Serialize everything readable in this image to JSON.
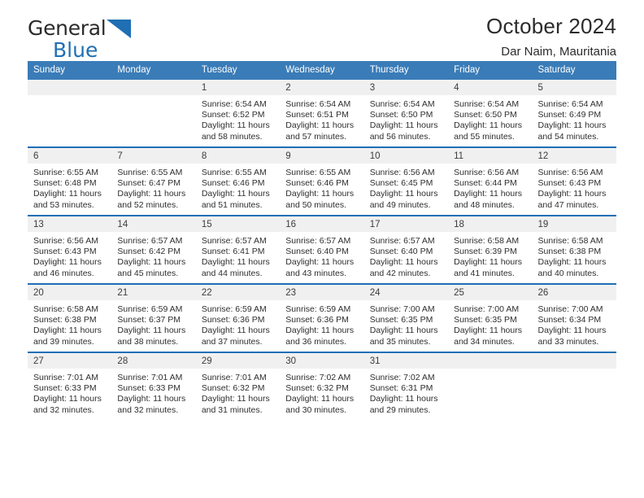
{
  "brand": {
    "line1": "General",
    "line2": "Blue",
    "triangle_color": "#1f6fb5",
    "icon": "triangle-logo-icon"
  },
  "header": {
    "title": "October 2024",
    "subtitle": "Dar Naim, Mauritania"
  },
  "theme": {
    "header_bg": "#3a7cb8",
    "row_divider": "#1f6fb5",
    "daynum_bg": "#f0f0f0",
    "text": "#2e2e2e"
  },
  "weekdays": [
    "Sunday",
    "Monday",
    "Tuesday",
    "Wednesday",
    "Thursday",
    "Friday",
    "Saturday"
  ],
  "weeks": [
    [
      {
        "day": "",
        "sunrise": "",
        "sunset": "",
        "daylight1": "",
        "daylight2": ""
      },
      {
        "day": "",
        "sunrise": "",
        "sunset": "",
        "daylight1": "",
        "daylight2": ""
      },
      {
        "day": "1",
        "sunrise": "Sunrise: 6:54 AM",
        "sunset": "Sunset: 6:52 PM",
        "daylight1": "Daylight: 11 hours",
        "daylight2": "and 58 minutes."
      },
      {
        "day": "2",
        "sunrise": "Sunrise: 6:54 AM",
        "sunset": "Sunset: 6:51 PM",
        "daylight1": "Daylight: 11 hours",
        "daylight2": "and 57 minutes."
      },
      {
        "day": "3",
        "sunrise": "Sunrise: 6:54 AM",
        "sunset": "Sunset: 6:50 PM",
        "daylight1": "Daylight: 11 hours",
        "daylight2": "and 56 minutes."
      },
      {
        "day": "4",
        "sunrise": "Sunrise: 6:54 AM",
        "sunset": "Sunset: 6:50 PM",
        "daylight1": "Daylight: 11 hours",
        "daylight2": "and 55 minutes."
      },
      {
        "day": "5",
        "sunrise": "Sunrise: 6:54 AM",
        "sunset": "Sunset: 6:49 PM",
        "daylight1": "Daylight: 11 hours",
        "daylight2": "and 54 minutes."
      }
    ],
    [
      {
        "day": "6",
        "sunrise": "Sunrise: 6:55 AM",
        "sunset": "Sunset: 6:48 PM",
        "daylight1": "Daylight: 11 hours",
        "daylight2": "and 53 minutes."
      },
      {
        "day": "7",
        "sunrise": "Sunrise: 6:55 AM",
        "sunset": "Sunset: 6:47 PM",
        "daylight1": "Daylight: 11 hours",
        "daylight2": "and 52 minutes."
      },
      {
        "day": "8",
        "sunrise": "Sunrise: 6:55 AM",
        "sunset": "Sunset: 6:46 PM",
        "daylight1": "Daylight: 11 hours",
        "daylight2": "and 51 minutes."
      },
      {
        "day": "9",
        "sunrise": "Sunrise: 6:55 AM",
        "sunset": "Sunset: 6:46 PM",
        "daylight1": "Daylight: 11 hours",
        "daylight2": "and 50 minutes."
      },
      {
        "day": "10",
        "sunrise": "Sunrise: 6:56 AM",
        "sunset": "Sunset: 6:45 PM",
        "daylight1": "Daylight: 11 hours",
        "daylight2": "and 49 minutes."
      },
      {
        "day": "11",
        "sunrise": "Sunrise: 6:56 AM",
        "sunset": "Sunset: 6:44 PM",
        "daylight1": "Daylight: 11 hours",
        "daylight2": "and 48 minutes."
      },
      {
        "day": "12",
        "sunrise": "Sunrise: 6:56 AM",
        "sunset": "Sunset: 6:43 PM",
        "daylight1": "Daylight: 11 hours",
        "daylight2": "and 47 minutes."
      }
    ],
    [
      {
        "day": "13",
        "sunrise": "Sunrise: 6:56 AM",
        "sunset": "Sunset: 6:43 PM",
        "daylight1": "Daylight: 11 hours",
        "daylight2": "and 46 minutes."
      },
      {
        "day": "14",
        "sunrise": "Sunrise: 6:57 AM",
        "sunset": "Sunset: 6:42 PM",
        "daylight1": "Daylight: 11 hours",
        "daylight2": "and 45 minutes."
      },
      {
        "day": "15",
        "sunrise": "Sunrise: 6:57 AM",
        "sunset": "Sunset: 6:41 PM",
        "daylight1": "Daylight: 11 hours",
        "daylight2": "and 44 minutes."
      },
      {
        "day": "16",
        "sunrise": "Sunrise: 6:57 AM",
        "sunset": "Sunset: 6:40 PM",
        "daylight1": "Daylight: 11 hours",
        "daylight2": "and 43 minutes."
      },
      {
        "day": "17",
        "sunrise": "Sunrise: 6:57 AM",
        "sunset": "Sunset: 6:40 PM",
        "daylight1": "Daylight: 11 hours",
        "daylight2": "and 42 minutes."
      },
      {
        "day": "18",
        "sunrise": "Sunrise: 6:58 AM",
        "sunset": "Sunset: 6:39 PM",
        "daylight1": "Daylight: 11 hours",
        "daylight2": "and 41 minutes."
      },
      {
        "day": "19",
        "sunrise": "Sunrise: 6:58 AM",
        "sunset": "Sunset: 6:38 PM",
        "daylight1": "Daylight: 11 hours",
        "daylight2": "and 40 minutes."
      }
    ],
    [
      {
        "day": "20",
        "sunrise": "Sunrise: 6:58 AM",
        "sunset": "Sunset: 6:38 PM",
        "daylight1": "Daylight: 11 hours",
        "daylight2": "and 39 minutes."
      },
      {
        "day": "21",
        "sunrise": "Sunrise: 6:59 AM",
        "sunset": "Sunset: 6:37 PM",
        "daylight1": "Daylight: 11 hours",
        "daylight2": "and 38 minutes."
      },
      {
        "day": "22",
        "sunrise": "Sunrise: 6:59 AM",
        "sunset": "Sunset: 6:36 PM",
        "daylight1": "Daylight: 11 hours",
        "daylight2": "and 37 minutes."
      },
      {
        "day": "23",
        "sunrise": "Sunrise: 6:59 AM",
        "sunset": "Sunset: 6:36 PM",
        "daylight1": "Daylight: 11 hours",
        "daylight2": "and 36 minutes."
      },
      {
        "day": "24",
        "sunrise": "Sunrise: 7:00 AM",
        "sunset": "Sunset: 6:35 PM",
        "daylight1": "Daylight: 11 hours",
        "daylight2": "and 35 minutes."
      },
      {
        "day": "25",
        "sunrise": "Sunrise: 7:00 AM",
        "sunset": "Sunset: 6:35 PM",
        "daylight1": "Daylight: 11 hours",
        "daylight2": "and 34 minutes."
      },
      {
        "day": "26",
        "sunrise": "Sunrise: 7:00 AM",
        "sunset": "Sunset: 6:34 PM",
        "daylight1": "Daylight: 11 hours",
        "daylight2": "and 33 minutes."
      }
    ],
    [
      {
        "day": "27",
        "sunrise": "Sunrise: 7:01 AM",
        "sunset": "Sunset: 6:33 PM",
        "daylight1": "Daylight: 11 hours",
        "daylight2": "and 32 minutes."
      },
      {
        "day": "28",
        "sunrise": "Sunrise: 7:01 AM",
        "sunset": "Sunset: 6:33 PM",
        "daylight1": "Daylight: 11 hours",
        "daylight2": "and 32 minutes."
      },
      {
        "day": "29",
        "sunrise": "Sunrise: 7:01 AM",
        "sunset": "Sunset: 6:32 PM",
        "daylight1": "Daylight: 11 hours",
        "daylight2": "and 31 minutes."
      },
      {
        "day": "30",
        "sunrise": "Sunrise: 7:02 AM",
        "sunset": "Sunset: 6:32 PM",
        "daylight1": "Daylight: 11 hours",
        "daylight2": "and 30 minutes."
      },
      {
        "day": "31",
        "sunrise": "Sunrise: 7:02 AM",
        "sunset": "Sunset: 6:31 PM",
        "daylight1": "Daylight: 11 hours",
        "daylight2": "and 29 minutes."
      },
      {
        "day": "",
        "sunrise": "",
        "sunset": "",
        "daylight1": "",
        "daylight2": ""
      },
      {
        "day": "",
        "sunrise": "",
        "sunset": "",
        "daylight1": "",
        "daylight2": ""
      }
    ]
  ]
}
